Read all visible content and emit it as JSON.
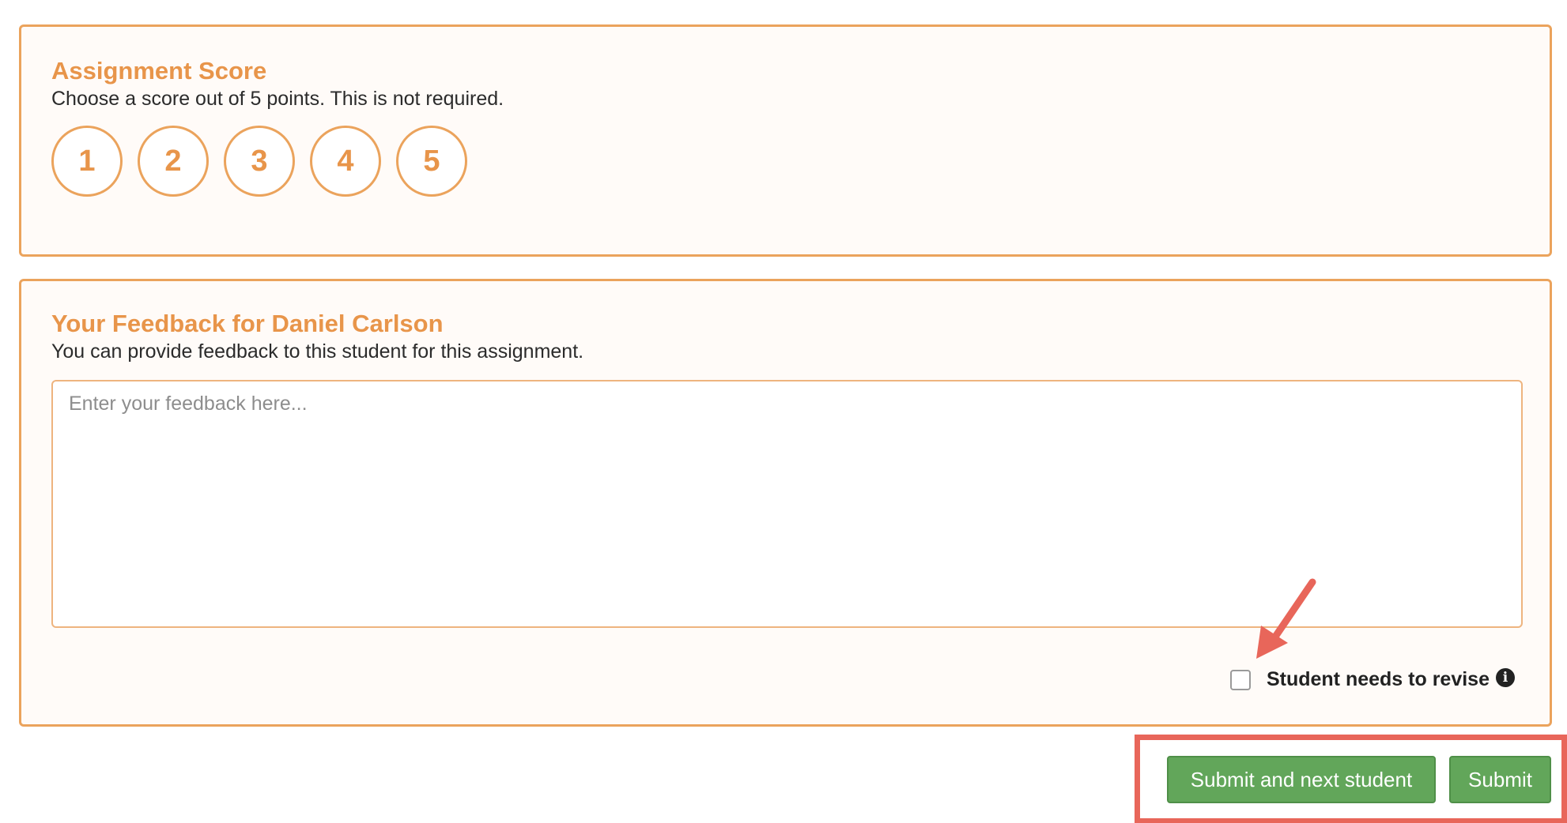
{
  "score_section": {
    "title": "Assignment Score",
    "description": "Choose a score out of 5 points. This is not required.",
    "options": [
      "1",
      "2",
      "3",
      "4",
      "5"
    ]
  },
  "feedback_section": {
    "title": "Your Feedback for Daniel Carlson",
    "description": "You can provide feedback to this student for this assignment.",
    "input_placeholder": "Enter your feedback here...",
    "input_value": "",
    "revise_label": "Student needs to revise",
    "revise_checked": false,
    "info_icon": "info-circle-icon"
  },
  "actions": {
    "submit_next_label": "Submit and next student",
    "submit_label": "Submit"
  },
  "colors": {
    "accent": "#e8954a",
    "card_border": "#eba35c",
    "button_green": "#62a65a",
    "annotation_red": "#e8665a"
  }
}
